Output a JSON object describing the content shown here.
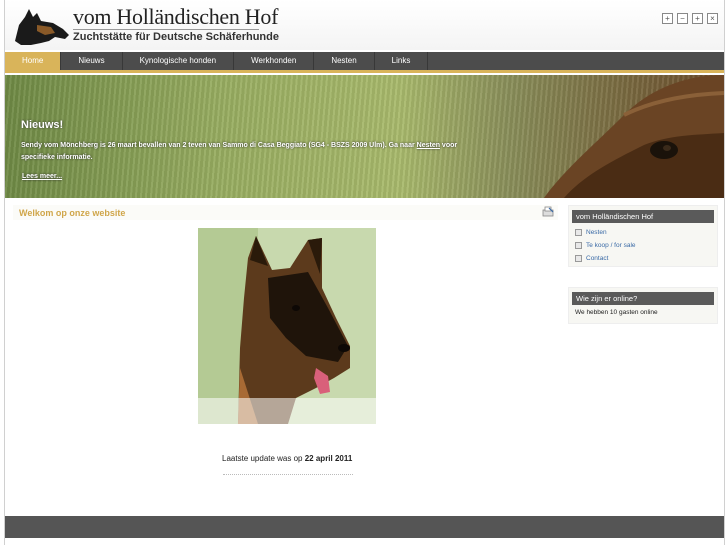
{
  "site": {
    "title": "vom Holländischen Hof",
    "subtitle": "Zuchtstätte für Deutsche Schäferhunde"
  },
  "tools": [
    "+",
    "−",
    "+",
    "×"
  ],
  "nav": {
    "items": [
      "Home",
      "Nieuws",
      "Kynologische honden",
      "Werkhonden",
      "Nesten",
      "Links"
    ],
    "active": "Home"
  },
  "banner": {
    "heading": "Nieuws!",
    "text_before_link": "Sendy vom Mönchberg is 26 maart bevallen van 2 teven van Sammo di Casa Beggiato (SG4 - BSZS 2009 Ulm). Ga naar ",
    "link_label": "Nesten",
    "text_after_link": " voor specifieke informatie.",
    "more_label": "Lees meer..."
  },
  "content": {
    "title": "Welkom op onze website",
    "update_prefix": "Laatste update was op ",
    "update_date": "22 april 2011"
  },
  "sidebar": {
    "menu_title": "vom Holländischen Hof",
    "menu_items": [
      "Nesten",
      "Te koop / for sale",
      "Contact"
    ],
    "online_title": "Wie zijn er online?",
    "online_text": "We hebben 10 gasten online"
  },
  "colors": {
    "accent": "#d9b45a",
    "nav_bg": "#4c4c4c",
    "link": "#3a6aa6"
  }
}
